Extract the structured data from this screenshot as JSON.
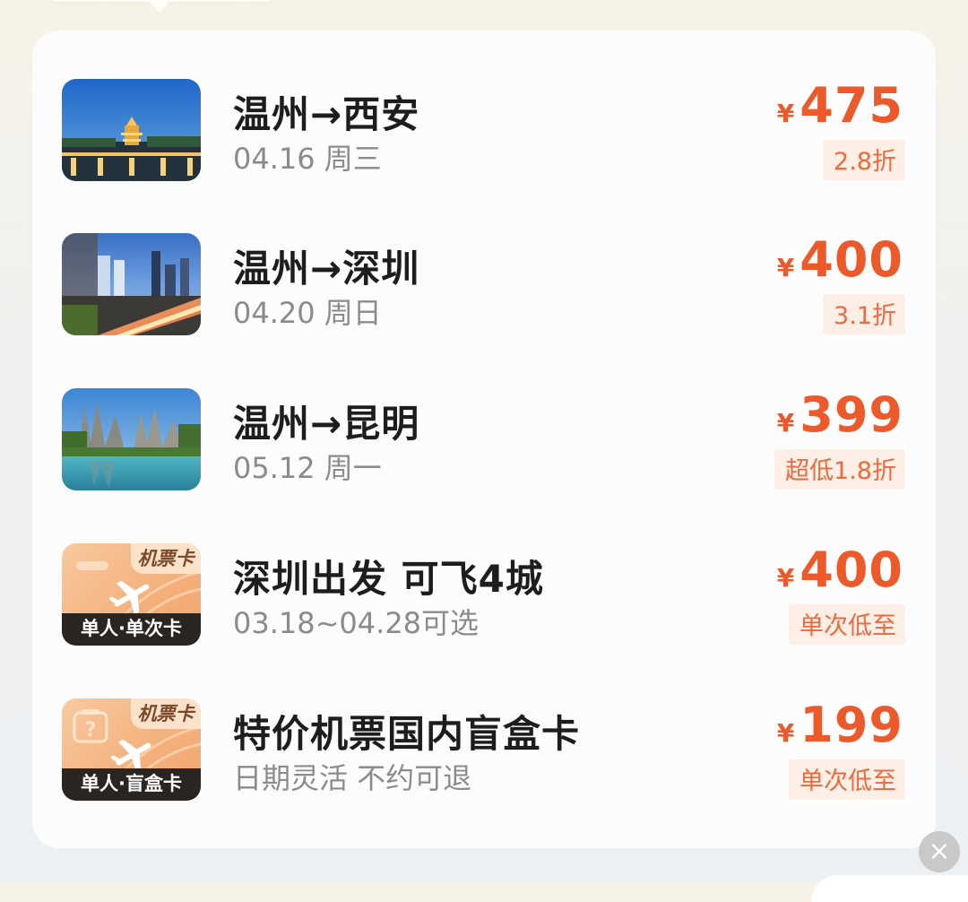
{
  "items": [
    {
      "title": "温州→西安",
      "subtitle": "04.16 周三",
      "currency": "¥",
      "price": "475",
      "tag": "2.8折",
      "thumb": "xian-pagoda-photo"
    },
    {
      "title": "温州→深圳",
      "subtitle": "04.20 周日",
      "currency": "¥",
      "price": "400",
      "tag": "3.1折",
      "thumb": "shenzhen-skyline-photo"
    },
    {
      "title": "温州→昆明",
      "subtitle": "05.12 周一",
      "currency": "¥",
      "price": "399",
      "tag": "超低1.8折",
      "thumb": "kunming-stone-forest-photo"
    },
    {
      "title": "深圳出发 可飞4城",
      "subtitle": "03.18~04.28可选",
      "currency": "¥",
      "price": "400",
      "tag": "单次低至",
      "thumb_badge": "机票卡",
      "thumb_label": "单人·单次卡"
    },
    {
      "title": "特价机票国内盲盒卡",
      "subtitle": "日期灵活 不约可退",
      "currency": "¥",
      "price": "199",
      "tag": "单次低至",
      "thumb_badge": "机票卡",
      "thumb_label": "单人·盲盒卡"
    }
  ],
  "close_symbol": "×",
  "colors": {
    "price": "#ec5a2b",
    "tag_bg": "#fdeee6",
    "card_bg": "#fcfcfc"
  }
}
